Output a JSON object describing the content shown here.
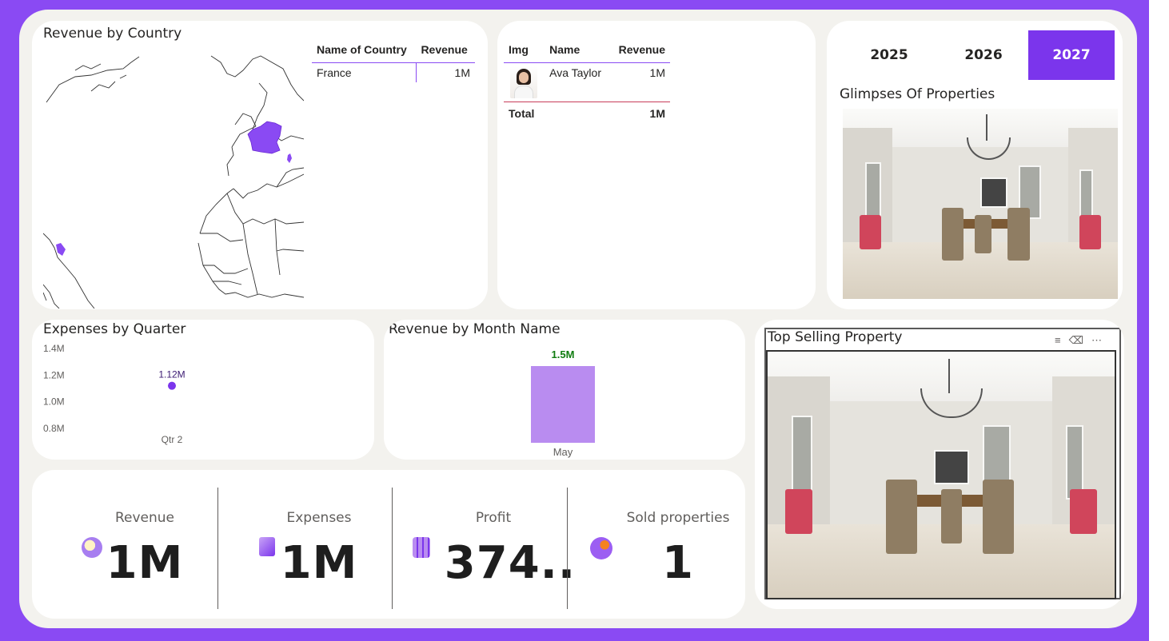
{
  "map_card": {
    "title": "Revenue by Country",
    "table": {
      "headers": [
        "Name of Country",
        "Revenue"
      ],
      "rows": [
        {
          "country": "France",
          "revenue": "1M"
        }
      ]
    },
    "highlight_color": "#8a4af3"
  },
  "people_card": {
    "headers": [
      "Img",
      "Name",
      "Revenue"
    ],
    "rows": [
      {
        "name": "Ava Taylor",
        "revenue": "1M"
      }
    ],
    "total": {
      "label": "Total",
      "value": "1M"
    }
  },
  "year_slicer": {
    "years": [
      "2025",
      "2026",
      "2027"
    ],
    "selected": "2027",
    "accent": "#7b35ec"
  },
  "glimpses": {
    "title": "Glimpses Of Properties"
  },
  "expenses_chart": {
    "chart_data": {
      "type": "scatter",
      "title": "Expenses by Quarter",
      "categories": [
        "Qtr 2"
      ],
      "values": [
        1120000
      ],
      "data_labels": [
        "1.12M"
      ],
      "yticks": [
        "1.4M",
        "1.2M",
        "1.0M",
        "0.8M"
      ],
      "ylim": [
        800000,
        1400000
      ],
      "color": "#7b35ec"
    }
  },
  "month_chart": {
    "chart_data": {
      "type": "bar",
      "title": "Revenue by Month Name",
      "categories": [
        "May"
      ],
      "values": [
        1500000
      ],
      "data_labels": [
        "1.5M"
      ],
      "color": "#b98cf0",
      "label_color": "#107c10"
    }
  },
  "top_selling": {
    "title": "Top Selling Property",
    "toolbar_icons": [
      "filter-icon",
      "eraser-icon",
      "more-icon"
    ]
  },
  "kpis": [
    {
      "label": "Revenue",
      "value": "1M",
      "icon": "compass-icon"
    },
    {
      "label": "Expenses",
      "value": "1M",
      "icon": "book-icon"
    },
    {
      "label": "Profit",
      "value": "374..",
      "icon": "calculator-icon"
    },
    {
      "label": "Sold properties",
      "value": "1",
      "icon": "globe-icon"
    }
  ]
}
